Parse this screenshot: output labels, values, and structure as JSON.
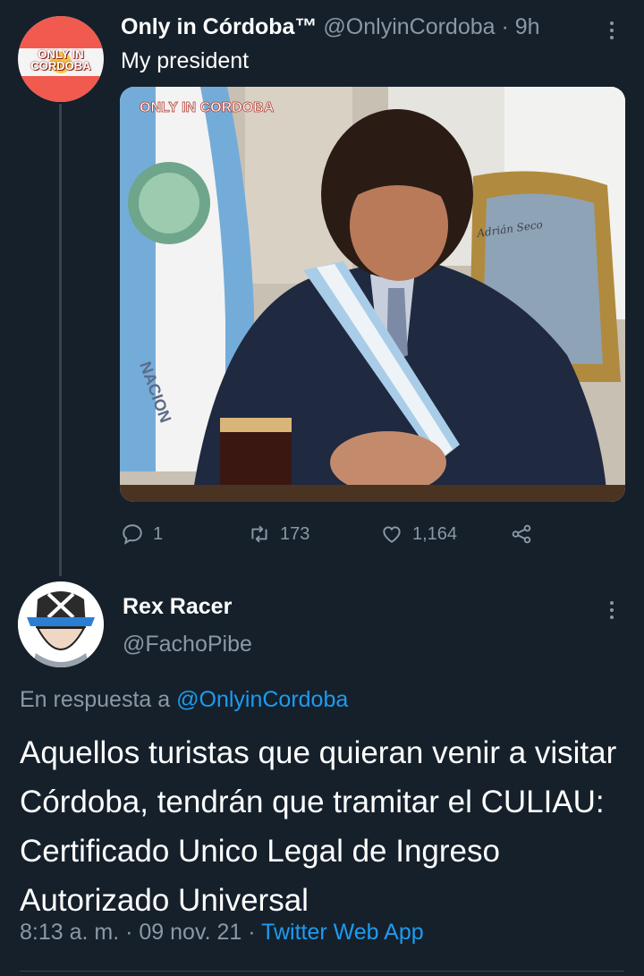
{
  "tweet1": {
    "display_name": "Only in Córdoba™",
    "handle": "@OnlyinCordoba",
    "separator": " · ",
    "time": "9h",
    "text": "My president",
    "avatar_text": "ONLY IN CORDOBA",
    "image": {
      "watermark": "ONLY IN CORDOBA",
      "flag_text": "NACION",
      "chair_text": "Adrián Seco"
    },
    "actions": {
      "replies": "1",
      "retweets": "173",
      "likes": "1,164"
    }
  },
  "tweet2": {
    "display_name": "Rex Racer",
    "handle": "@FachoPibe",
    "reply_prefix": "En respuesta a ",
    "reply_to": "@OnlyinCordoba",
    "text": "Aquellos turistas que quieran venir a visitar Córdoba, tendrán que tramitar el CULIAU: Certificado Unico Legal de Ingreso Autorizado Universal",
    "time": "8:13 a. m.",
    "dot": " · ",
    "date": "09 nov. 21",
    "source": "Twitter Web App"
  },
  "colors": {
    "background": "#15202b",
    "text_primary": "#ffffff",
    "text_secondary": "#8b98a5",
    "link": "#1d9bf0",
    "divider": "#38444d"
  },
  "icons": [
    "reply-icon",
    "retweet-icon",
    "like-icon",
    "share-icon",
    "more-icon"
  ]
}
